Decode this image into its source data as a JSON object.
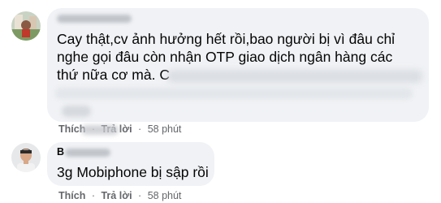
{
  "comments": [
    {
      "text_lines": [
        "Cay thật,cv ảnh hưởng hết rồi,bao người bị vì đâu chỉ",
        "nghe gọi đâu còn nhận OTP giao dịch ngân hàng các",
        "thứ nữa cơ mà. C"
      ],
      "actions": {
        "like": "Thích",
        "reply": "Trả lời",
        "time": "58 phút"
      }
    },
    {
      "author_initial": "B",
      "text": "3g Mobiphone bị sập rồi",
      "actions": {
        "like": "Thích",
        "reply": "Trả lời",
        "time": "58 phút"
      }
    }
  ],
  "colors": {
    "bubble": "#f0f2f5",
    "text": "#050505",
    "meta": "#65676b"
  }
}
